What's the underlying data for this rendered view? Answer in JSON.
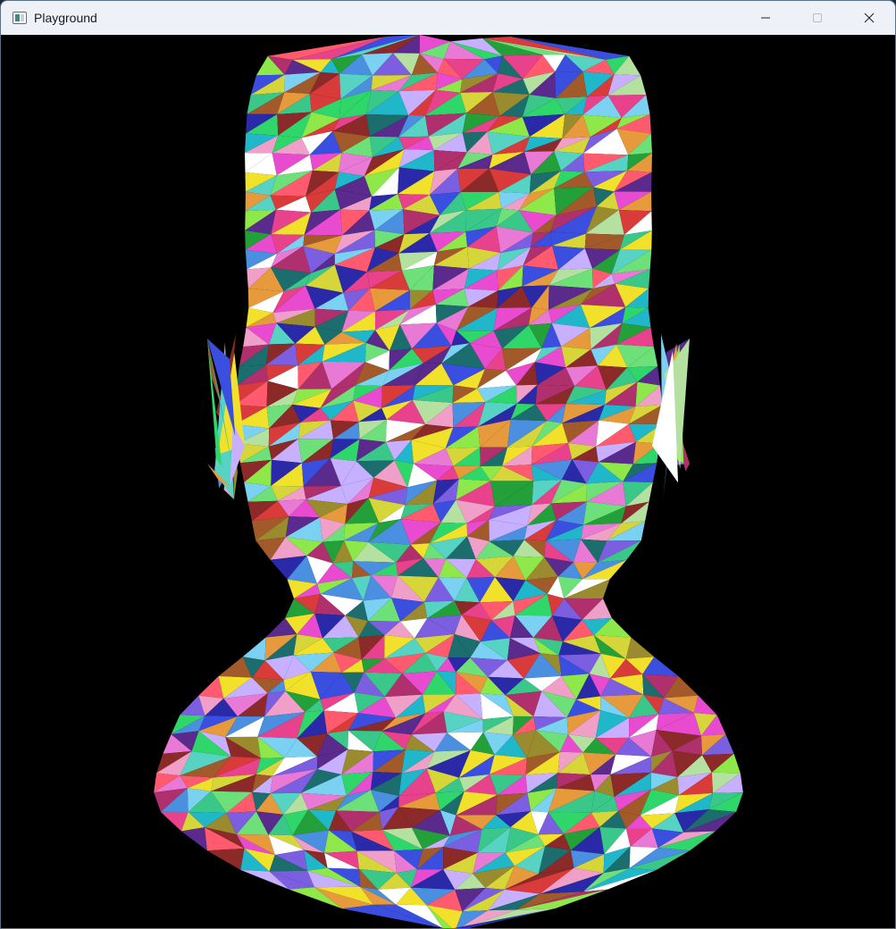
{
  "window": {
    "title": "Playground",
    "icon": "app-window-icon"
  },
  "titlebar_buttons": [
    {
      "name": "minimize",
      "icon": "minimize-icon"
    },
    {
      "name": "maximize",
      "icon": "maximize-icon"
    },
    {
      "name": "close",
      "icon": "close-icon"
    }
  ],
  "viewport": {
    "background": "#000000",
    "content": "rainbow-triangle-head-mesh"
  }
}
